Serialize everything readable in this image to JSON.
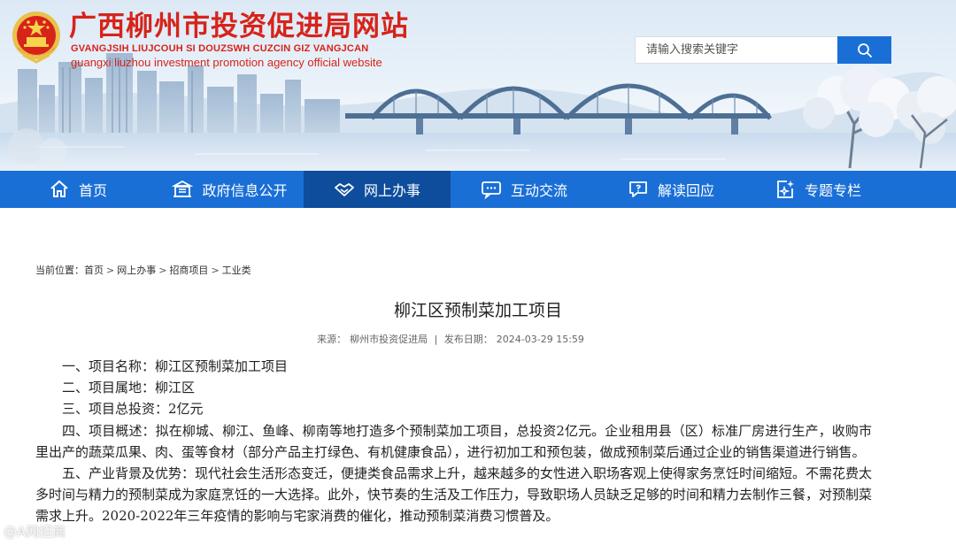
{
  "header": {
    "title": "广西柳州市投资促进局网站",
    "subtitle_zhuang": "GVANGJSIH LIUJCOUH SI DOUZSWH CUZCIN GIZ VANGJCAN",
    "subtitle_en": "guangxi liuzhou investment promotion agency official website"
  },
  "search": {
    "placeholder": "请输入搜索关键字",
    "icon": "search-icon"
  },
  "nav": {
    "items": [
      {
        "label": "首页",
        "icon": "home-icon"
      },
      {
        "label": "政府信息公开",
        "icon": "building-icon"
      },
      {
        "label": "网上办事",
        "icon": "handshake-icon",
        "active": true
      },
      {
        "label": "互动交流",
        "icon": "chat-icon"
      },
      {
        "label": "解读回应",
        "icon": "question-chat-icon"
      },
      {
        "label": "专题专栏",
        "icon": "sparkle-doc-icon"
      }
    ]
  },
  "breadcrumb": {
    "prefix": "当前位置：",
    "items": [
      "首页",
      "网上办事",
      "招商项目",
      "工业类"
    ]
  },
  "article": {
    "title": "柳江区预制菜加工项目",
    "source_label": "来源：",
    "source": "柳州市投资促进局",
    "divider": "|",
    "date_label": "发布日期：",
    "date": "2024-03-29 15:59",
    "paragraphs": [
      "一、项目名称：柳江区预制菜加工项目",
      "二、项目属地：柳江区",
      "三、项目总投资：2亿元",
      "四、项目概述：拟在柳城、柳江、鱼峰、柳南等地打造多个预制菜加工项目，总投资2亿元。企业租用县（区）标准厂房进行生产，收购市里出产的蔬菜瓜果、肉、蛋等食材（部分产品主打绿色、有机健康食品），进行初加工和预包装，做成预制菜后通过企业的销售渠道进行销售。",
      "五、产业背景及优势：现代社会生活形态变迁，便捷类食品需求上升，越来越多的女性进入职场客观上使得家务烹饪时间缩短。不需花费太多时间与精力的预制菜成为家庭烹饪的一大选择。此外，快节奏的生活及工作压力，导致职场人员缺乏足够的时间和精力去制作三餐，对预制菜需求上升。2020-2022年三年疫情的影响与宅家消费的催化，推动预制菜消费习惯普及。"
    ]
  },
  "watermark": {
    "text": "@A网招商"
  },
  "colors": {
    "brand_red": "#d7231a",
    "nav_blue": "#1a6fd6",
    "nav_active": "#0e4c9c"
  }
}
